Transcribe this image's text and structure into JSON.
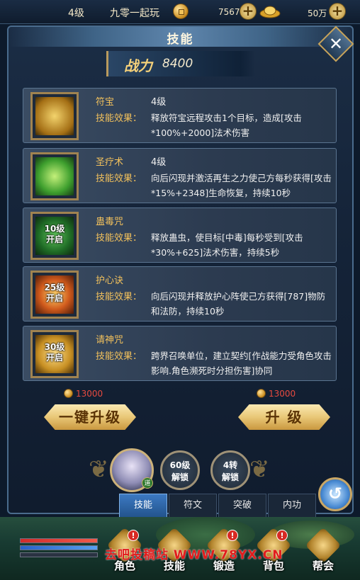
{
  "topbar": {
    "level": "4级",
    "player_name": "九零一起玩",
    "coins": "7567",
    "ingots": "50万"
  },
  "panel": {
    "title": "技能"
  },
  "power": {
    "label": "战力",
    "value": "8400"
  },
  "skills": [
    {
      "name": "符宝",
      "level": "4级",
      "effect_label": "技能效果：",
      "effect": "释放符宝远程攻击1个目标，造成[攻击*100%+2000]法术伤害",
      "lock": "",
      "icon": "talisman-icon",
      "color": "#c99b27"
    },
    {
      "name": "圣疗术",
      "level": "4级",
      "effect_label": "技能效果：",
      "effect": "向后闪现并激活再生之力使己方每秒获得[攻击*15%+2348]生命恢复，持续10秒",
      "lock": "",
      "icon": "heal-icon",
      "color": "#4bb23a"
    },
    {
      "name": "蛊毒咒",
      "level": "",
      "effect_label": "技能效果：",
      "effect": "释放蛊虫，使目标[中毒]每秒受到[攻击*30%+625]法术伤害，持续5秒",
      "lock": "10级\n开启",
      "icon": "poison-icon",
      "color": "#2f8d3a"
    },
    {
      "name": "护心诀",
      "level": "",
      "effect_label": "技能效果：",
      "effect": "向后闪现并释放护心阵使己方获得[787]物防和法防，持续10秒",
      "lock": "25级\n开启",
      "icon": "shield-icon",
      "color": "#c4521f"
    },
    {
      "name": "请神咒",
      "level": "",
      "effect_label": "技能效果：",
      "effect": "跨界召唤单位，建立契约[作战能力受角色攻击影响.角色濒死时分担伤害]协同",
      "lock": "30级\n开启",
      "icon": "summon-icon",
      "color": "#c7962d"
    }
  ],
  "costs": {
    "left": "13000",
    "right": "13000"
  },
  "buttons": {
    "one_key_upgrade": "一键升级",
    "upgrade": "升 级"
  },
  "unlocks": [
    "60级\n解锁",
    "4转\n解锁"
  ],
  "avatar_badge": "道",
  "tabs": [
    "技能",
    "符文",
    "突破",
    "内功"
  ],
  "bottom_menu": [
    {
      "label": "角色",
      "badge": "!"
    },
    {
      "label": "技能",
      "badge": ""
    },
    {
      "label": "锻造",
      "badge": "!"
    },
    {
      "label": "背包",
      "badge": "!"
    },
    {
      "label": "帮会",
      "badge": ""
    }
  ],
  "watermark": "去吧投稿站 WWW.78YX.CN",
  "colors": {
    "gold": "#f2c15c",
    "cost_red": "#e74a3f",
    "tab_active": "#3c79c2"
  }
}
